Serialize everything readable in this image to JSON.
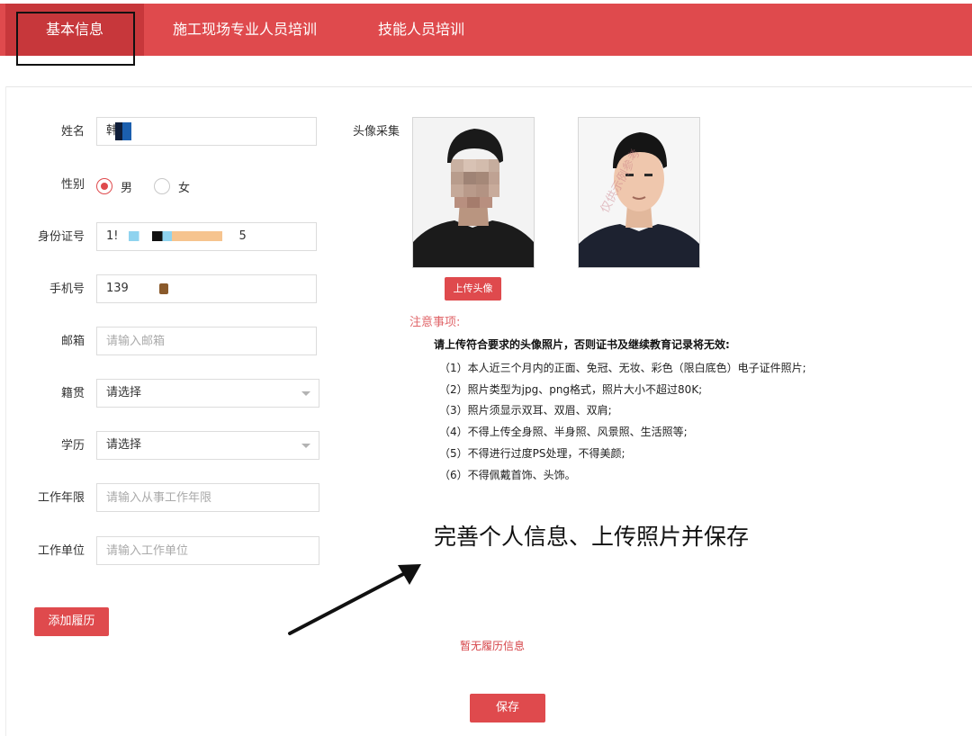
{
  "tabs": [
    {
      "label": "基本信息",
      "active": true
    },
    {
      "label": "施工现场专业人员培训",
      "active": false
    },
    {
      "label": "技能人员培训",
      "active": false
    }
  ],
  "form": {
    "name": {
      "label": "姓名",
      "value": "韩"
    },
    "gender": {
      "label": "性别",
      "options": [
        "男",
        "女"
      ],
      "selected": "男"
    },
    "id_card": {
      "label": "身份证号",
      "value_start": "1!",
      "value_end": "5"
    },
    "phone": {
      "label": "手机号",
      "value": "139"
    },
    "email": {
      "label": "邮箱",
      "placeholder": "请输入邮箱"
    },
    "native_place": {
      "label": "籍贯",
      "value": "请选择"
    },
    "education": {
      "label": "学历",
      "value": "请选择"
    },
    "work_years": {
      "label": "工作年限",
      "placeholder": "请输入从事工作年限"
    },
    "employer": {
      "label": "工作单位",
      "placeholder": "请输入工作单位"
    }
  },
  "photo": {
    "label": "头像采集",
    "sample_watermark": "仅供示例参考",
    "upload_button": "上传头像"
  },
  "notes": {
    "title": "注意事项:",
    "lead": "请上传符合要求的头像照片，否则证书及继续教育记录将无效:",
    "items": [
      "（1）本人近三个月内的正面、免冠、无妆、彩色（限白底色）电子证件照片;",
      "（2）照片类型为jpg、png格式，照片大小不超过80K;",
      "（3）照片须显示双耳、双眉、双肩;",
      "（4）不得上传全身照、半身照、风景照、生活照等;",
      "（5）不得进行过度PS处理，不得美颜;",
      "（6）不得佩戴首饰、头饰。"
    ]
  },
  "annotation": "完善个人信息、上传照片并保存",
  "resume": {
    "add_button": "添加履历",
    "empty_text": "暂无履历信息"
  },
  "save_button": "保存",
  "colors": {
    "brand": "#df4a4d",
    "brand_dark": "#c7373b",
    "notes_title": "#e0666a"
  }
}
